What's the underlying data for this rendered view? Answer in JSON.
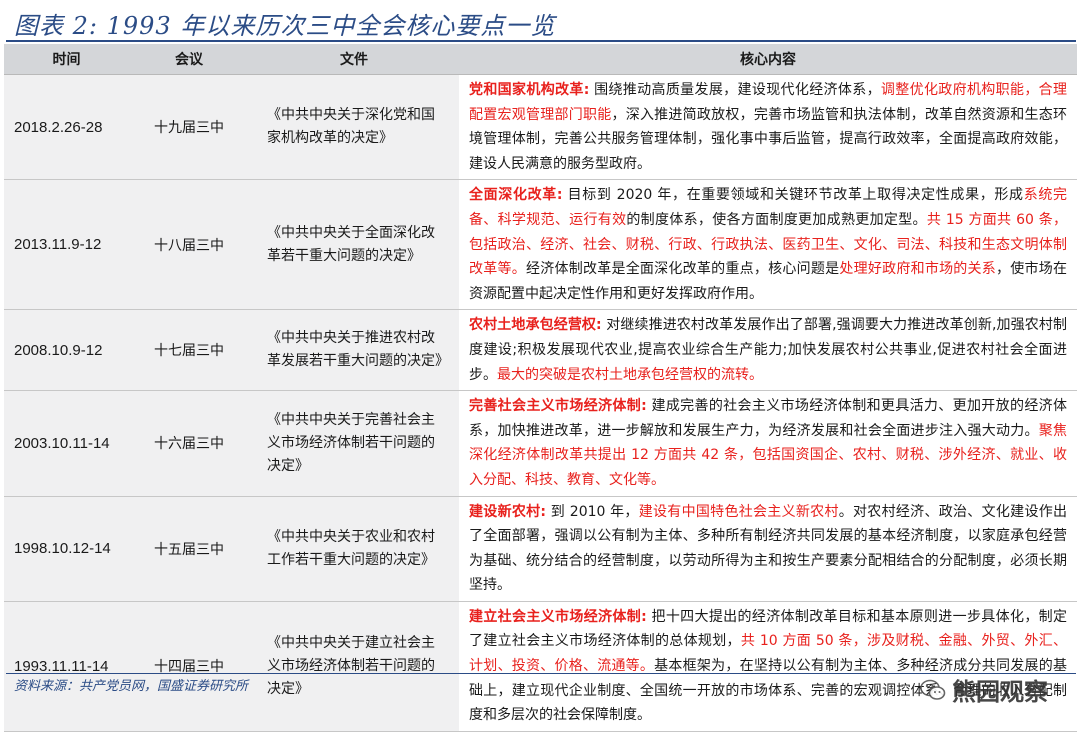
{
  "title": "图表 2: 1993 年以来历次三中全会核心要点一览",
  "table": {
    "headers": [
      "时间",
      "会议",
      "文件",
      "核心内容"
    ],
    "rows": [
      {
        "date": "2018.2.26-28",
        "meeting": "十九届三中",
        "document": "《中共中央关于深化党和国家机构改革的决定》",
        "content": [
          {
            "t": "党和国家机构改革:",
            "s": "redb"
          },
          {
            "t": " 围绕推动高质量发展，建设现代化经济体系，",
            "s": ""
          },
          {
            "t": "调整优化政府机构职能，合理配置宏观管理部门职能",
            "s": "red"
          },
          {
            "t": "，深入推进简政放权，完善市场监管和执法体制，改革自然资源和生态环境管理体制，完善公共服务管理体制，强化事中事后监管，提高行政效率，全面提高政府效能，建设人民满意的服务型政府。",
            "s": ""
          }
        ]
      },
      {
        "date": "2013.11.9-12",
        "meeting": "十八届三中",
        "document": "《中共中央关于全面深化改革若干重大问题的决定》",
        "content": [
          {
            "t": "全面深化改革:",
            "s": "redb"
          },
          {
            "t": " 目标到 2020 年，在重要领域和关键环节改革上取得决定性成果，形成",
            "s": ""
          },
          {
            "t": "系统完备、科学规范、运行有效",
            "s": "red"
          },
          {
            "t": "的制度体系，使各方面制度更加成熟更加定型。",
            "s": ""
          },
          {
            "t": "共 15 方面共 60 条，包括政治、经济、社会、财税、行政、行政执法、医药卫生、文化、司法、科技和生态文明体制改革等。",
            "s": "red"
          },
          {
            "t": "经济体制改革是全面深化改革的重点，核心问题是",
            "s": ""
          },
          {
            "t": "处理好政府和市场的关系",
            "s": "red"
          },
          {
            "t": "，使市场在资源配置中起决定性作用和更好发挥政府作用。",
            "s": ""
          }
        ]
      },
      {
        "date": "2008.10.9-12",
        "meeting": "十七届三中",
        "document": "《中共中央关于推进农村改革发展若干重大问题的决定》",
        "content": [
          {
            "t": "农村土地承包经营权:",
            "s": "redb"
          },
          {
            "t": " 对继续推进农村改革发展作出了部署,强调要大力推进改革创新,加强农村制度建设;积极发展现代农业,提高农业综合生产能力;加快发展农村公共事业,促进农村社会全面进步。",
            "s": ""
          },
          {
            "t": "最大的突破是农村土地承包经营权的流转。",
            "s": "red"
          }
        ]
      },
      {
        "date": "2003.10.11-14",
        "meeting": "十六届三中",
        "document": "《中共中央关于完善社会主义市场经济体制若干问题的决定》",
        "content": [
          {
            "t": "完善社会主义市场经济体制:",
            "s": "redb"
          },
          {
            "t": " 建成完善的社会主义市场经济体制和更具活力、更加开放的经济体系，加快推进改革，进一步解放和发展生产力，为经济发展和社会全面进步注入强大动力。",
            "s": ""
          },
          {
            "t": "聚焦深化经济体制改革共提出 12 方面共 42 条，包括国资国企、农村、财税、涉外经济、就业、收入分配、科技、教育、文化等。",
            "s": "red"
          }
        ]
      },
      {
        "date": "1998.10.12-14",
        "meeting": "十五届三中",
        "document": "《中共中央关于农业和农村工作若干重大问题的决定》",
        "content": [
          {
            "t": "建设新农村:",
            "s": "redb"
          },
          {
            "t": " 到 2010 年，",
            "s": ""
          },
          {
            "t": "建设有中国特色社会主义新农村",
            "s": "red"
          },
          {
            "t": "。对农村经济、政治、文化建设作出了全面部署，强调以公有制为主体、多种所有制经济共同发展的基本经济制度，以家庭承包经营为基础、统分结合的经营制度，以劳动所得为主和按生产要素分配相结合的分配制度，必须长期坚持。",
            "s": ""
          }
        ]
      },
      {
        "date": "1993.11.11-14",
        "meeting": "十四届三中",
        "document": "《中共中央关于建立社会主义市场经济体制若干问题的决定》",
        "content": [
          {
            "t": "建立社会主义市场经济体制:",
            "s": "redb"
          },
          {
            "t": " 把十四大提出的经济体制改革目标和基本原则进一步具体化，制定了建立社会主义市场经济体制的总体规划，",
            "s": ""
          },
          {
            "t": "共 10 方面 50 条，涉及财税、金融、外贸、外汇、计划、投资、价格、流通等。",
            "s": "red"
          },
          {
            "t": "基本框架为，在坚持以公有制为主体、多种经济成分共同发展的基础上，建立现代企业制度、全国统一开放的市场体系、完善的宏观调控体系、合理的收入分配制度和多层次的社会保障制度。",
            "s": ""
          }
        ]
      }
    ]
  },
  "source": "资料来源：共产党员网，国盛证券研究所",
  "watermark": "熊园观察"
}
